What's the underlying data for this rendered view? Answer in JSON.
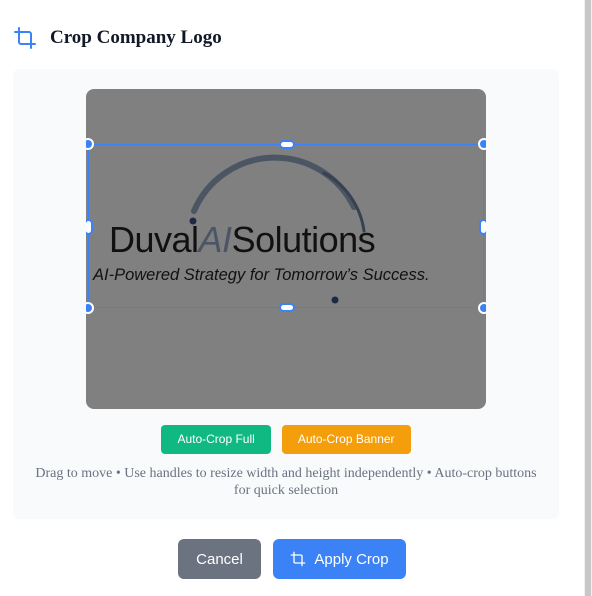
{
  "dialog": {
    "title": "Crop Company Logo",
    "icon": "crop-icon"
  },
  "image": {
    "brand_name_dark_1": "Duval",
    "brand_name_accent": "AI",
    "brand_name_dark_2": "Solutions",
    "tagline": "AI-Powered Strategy for Tomorrow’s Success."
  },
  "auto_crop": {
    "full_label": "Auto-Crop Full",
    "banner_label": "Auto-Crop Banner"
  },
  "hint": "Drag to move • Use handles to resize width and height independently • Auto-crop buttons for quick selection",
  "footer": {
    "cancel_label": "Cancel",
    "apply_label": "Apply Crop",
    "apply_icon": "crop-icon"
  },
  "colors": {
    "accent": "#3b82f6",
    "success": "#10b981",
    "warning": "#f59e0b",
    "neutral": "#6b7280"
  }
}
